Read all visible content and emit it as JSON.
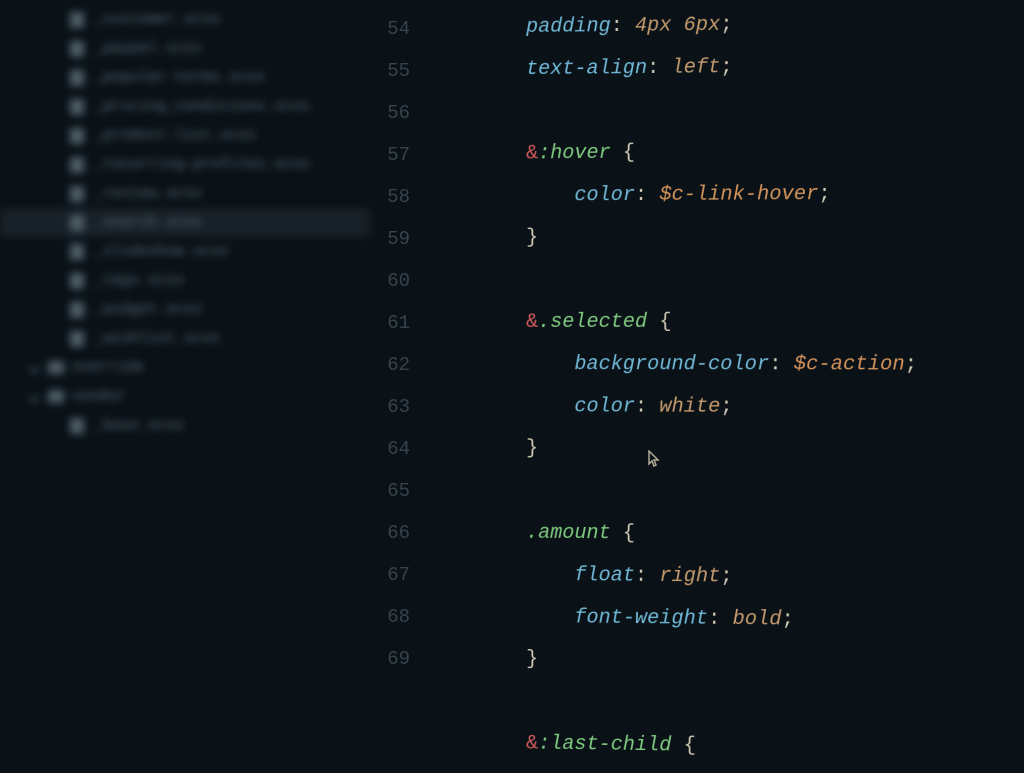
{
  "sidebar": {
    "files": [
      {
        "name": "_customer.scss",
        "selected": false
      },
      {
        "name": "_paypal.scss",
        "selected": false
      },
      {
        "name": "_popular-terms.scss",
        "selected": false
      },
      {
        "name": "_pricing_conditions.scss",
        "selected": false
      },
      {
        "name": "_product-list.scss",
        "selected": false
      },
      {
        "name": "_recurring-profiles.scss",
        "selected": false
      },
      {
        "name": "_review.scss",
        "selected": false
      },
      {
        "name": "_search.scss",
        "selected": true
      },
      {
        "name": "_slideshow.scss",
        "selected": false
      },
      {
        "name": "_tags.scss",
        "selected": false
      },
      {
        "name": "_widget.scss",
        "selected": false
      },
      {
        "name": "_wishlist.scss",
        "selected": false
      }
    ],
    "folders": [
      {
        "name": "override"
      },
      {
        "name": "vendor"
      }
    ],
    "subfile": {
      "name": "_base.scss"
    }
  },
  "gutter": {
    "start": 54,
    "end": 69
  },
  "code": {
    "lines": [
      {
        "indent": 4,
        "parts": [
          {
            "c": "prop",
            "t": "padding"
          },
          {
            "c": "punct",
            "t": ": "
          },
          {
            "c": "val",
            "t": "4px 6px"
          },
          {
            "c": "punct",
            "t": ";"
          }
        ]
      },
      {
        "indent": 4,
        "parts": [
          {
            "c": "prop",
            "t": "text-align"
          },
          {
            "c": "punct",
            "t": ": "
          },
          {
            "c": "val",
            "t": "left"
          },
          {
            "c": "punct",
            "t": ";"
          }
        ]
      },
      {
        "indent": 0,
        "parts": []
      },
      {
        "indent": 4,
        "parts": [
          {
            "c": "amp",
            "t": "&"
          },
          {
            "c": "pseudo",
            "t": ":hover"
          },
          {
            "c": "punct",
            "t": " {"
          }
        ]
      },
      {
        "indent": 6,
        "parts": [
          {
            "c": "prop",
            "t": "color"
          },
          {
            "c": "punct",
            "t": ": "
          },
          {
            "c": "var",
            "t": "$c-link-hover"
          },
          {
            "c": "punct",
            "t": ";"
          }
        ]
      },
      {
        "indent": 4,
        "parts": [
          {
            "c": "punct",
            "t": "}"
          }
        ]
      },
      {
        "indent": 0,
        "parts": []
      },
      {
        "indent": 4,
        "parts": [
          {
            "c": "amp",
            "t": "&"
          },
          {
            "c": "class",
            "t": ".selected"
          },
          {
            "c": "punct",
            "t": " {"
          }
        ]
      },
      {
        "indent": 6,
        "parts": [
          {
            "c": "prop",
            "t": "background-color"
          },
          {
            "c": "punct",
            "t": ": "
          },
          {
            "c": "var",
            "t": "$c-action"
          },
          {
            "c": "punct",
            "t": ";"
          }
        ]
      },
      {
        "indent": 6,
        "parts": [
          {
            "c": "prop",
            "t": "color"
          },
          {
            "c": "punct",
            "t": ": "
          },
          {
            "c": "val",
            "t": "white"
          },
          {
            "c": "punct",
            "t": ";"
          }
        ]
      },
      {
        "indent": 4,
        "parts": [
          {
            "c": "punct",
            "t": "}"
          }
        ]
      },
      {
        "indent": 0,
        "parts": []
      },
      {
        "indent": 4,
        "parts": [
          {
            "c": "class",
            "t": ".amount"
          },
          {
            "c": "punct",
            "t": " {"
          }
        ]
      },
      {
        "indent": 6,
        "parts": [
          {
            "c": "prop",
            "t": "float"
          },
          {
            "c": "punct",
            "t": ": "
          },
          {
            "c": "val",
            "t": "right"
          },
          {
            "c": "punct",
            "t": ";"
          }
        ]
      },
      {
        "indent": 6,
        "parts": [
          {
            "c": "prop",
            "t": "font-weight"
          },
          {
            "c": "punct",
            "t": ": "
          },
          {
            "c": "val",
            "t": "bold"
          },
          {
            "c": "punct",
            "t": ";"
          }
        ]
      },
      {
        "indent": 4,
        "parts": [
          {
            "c": "punct",
            "t": "}"
          }
        ]
      },
      {
        "indent": 0,
        "parts": []
      },
      {
        "indent": 4,
        "parts": [
          {
            "c": "amp",
            "t": "&"
          },
          {
            "c": "pseudo",
            "t": ":last-child"
          },
          {
            "c": "punct",
            "t": " {"
          }
        ]
      }
    ]
  }
}
